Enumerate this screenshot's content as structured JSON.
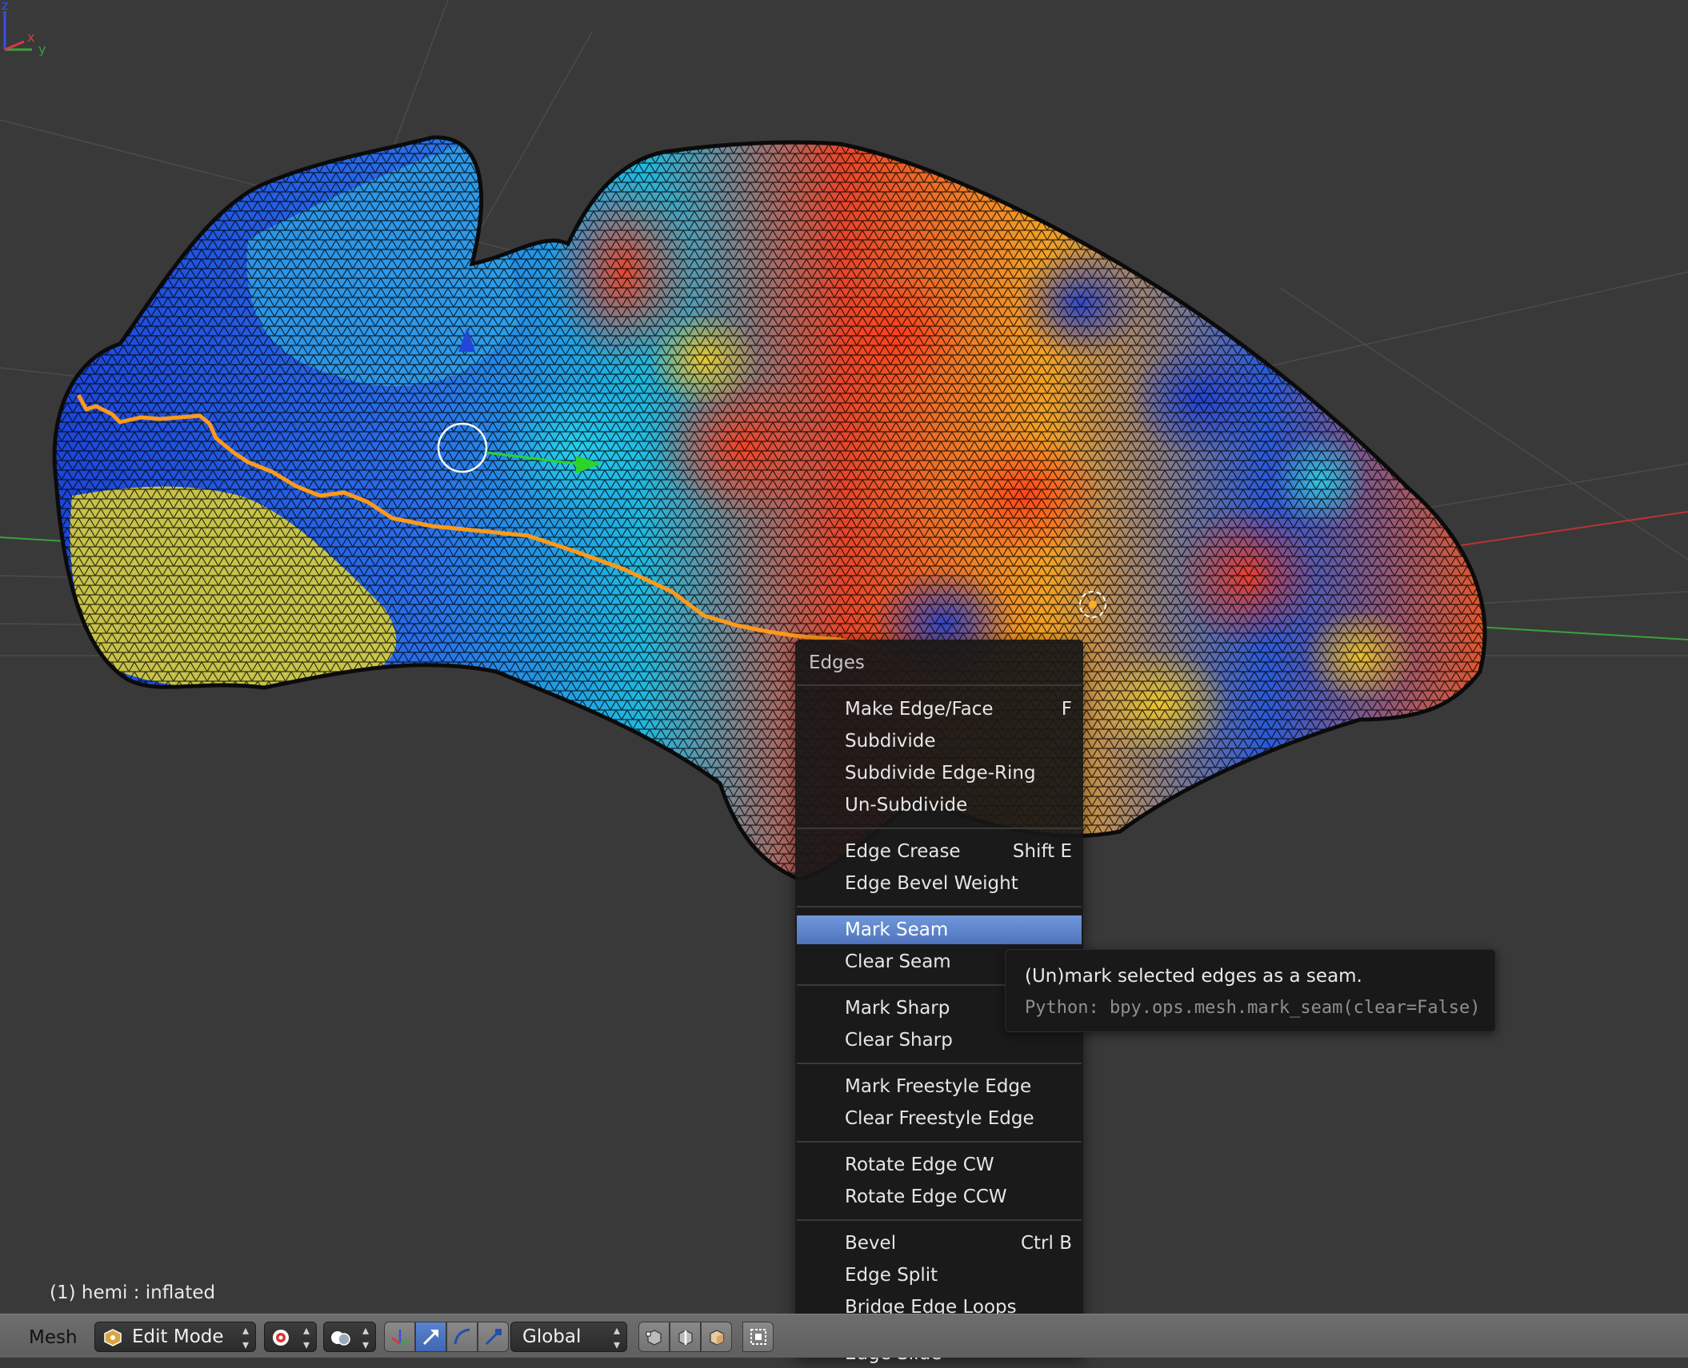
{
  "viewport": {
    "object_info": "(1) hemi : inflated",
    "axis_labels": {
      "z": "z",
      "x": "x",
      "y": "y"
    },
    "colors": {
      "background": "#393939",
      "x_axis": "#c23a3a",
      "y_axis": "#3da33d",
      "seam": "#ff9a1a"
    }
  },
  "edges_menu": {
    "title": "Edges",
    "items": [
      {
        "label": "Make Edge/Face",
        "shortcut": "F"
      },
      {
        "label": "Subdivide",
        "shortcut": ""
      },
      {
        "label": "Subdivide Edge-Ring",
        "shortcut": ""
      },
      {
        "label": "Un-Subdivide",
        "shortcut": ""
      },
      {
        "label": "Edge Crease",
        "shortcut": "Shift E"
      },
      {
        "label": "Edge Bevel Weight",
        "shortcut": ""
      },
      {
        "label": "Mark Seam",
        "shortcut": "",
        "active": true
      },
      {
        "label": "Clear Seam",
        "shortcut": ""
      },
      {
        "label": "Mark Sharp",
        "shortcut": ""
      },
      {
        "label": "Clear Sharp",
        "shortcut": ""
      },
      {
        "label": "Mark Freestyle Edge",
        "shortcut": ""
      },
      {
        "label": "Clear Freestyle Edge",
        "shortcut": ""
      },
      {
        "label": "Rotate Edge CW",
        "shortcut": ""
      },
      {
        "label": "Rotate Edge CCW",
        "shortcut": ""
      },
      {
        "label": "Bevel",
        "shortcut": "Ctrl B"
      },
      {
        "label": "Edge Split",
        "shortcut": ""
      },
      {
        "label": "Bridge Edge Loops",
        "shortcut": ""
      },
      {
        "label": "Edge Slide",
        "shortcut": ""
      }
    ]
  },
  "tooltip": {
    "description": "(Un)mark selected edges as a seam.",
    "python": "Python: bpy.ops.mesh.mark_seam(clear=False)"
  },
  "header": {
    "menu_label": "Mesh",
    "mode": "Edit Mode",
    "orientation": "Global",
    "icons": [
      "mode-icon",
      "pivot-icon",
      "shading-icon",
      "manipulator-icon",
      "translate-icon",
      "rotate-icon",
      "scale-icon",
      "vertex-select-icon",
      "edge-select-icon",
      "face-select-icon",
      "occlude-icon"
    ]
  }
}
